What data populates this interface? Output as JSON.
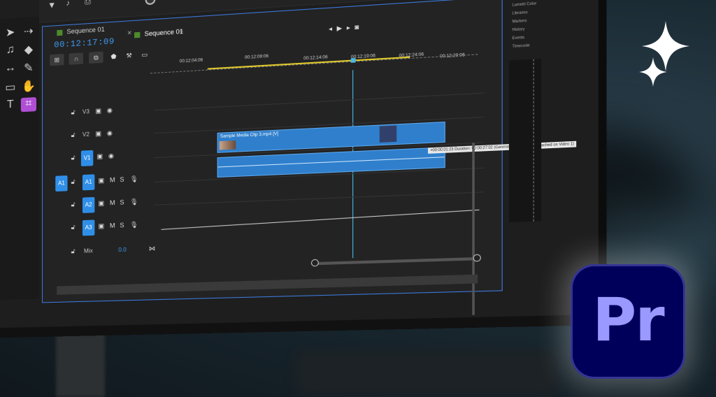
{
  "sequence": {
    "tab_inactive": "Sequence 01",
    "tab_active": "Sequence 01",
    "timecode": "00:12:17:09"
  },
  "ruler": {
    "labels": [
      "00:12:04:06",
      "00:12:09:06",
      "00:12:14:06",
      "00:12:19:06",
      "00:12:24:06",
      "00:12:29:06"
    ]
  },
  "tracks": {
    "video": [
      {
        "label": "V3"
      },
      {
        "label": "V2"
      },
      {
        "label": "V1",
        "source": "V1"
      }
    ],
    "audio": [
      {
        "label": "A1",
        "source": "A1"
      },
      {
        "label": "A2"
      },
      {
        "label": "A3"
      }
    ],
    "mix_label": "Mix",
    "mix_value": "0.0",
    "mute": "M",
    "solo": "S"
  },
  "clip": {
    "name": "Sample Media Clip 3.mp4 [V]",
    "tooltip": "+00:00:01:23 Duration: 00:00:27:02 (Generative extend limit reached on Video 1)"
  },
  "side_panel": [
    "Lumetri Color",
    "Libraries",
    "Markers",
    "History",
    "Events",
    "Timecode"
  ],
  "logo": {
    "text": "Pr"
  },
  "colors": {
    "accent": "#2f8fe8",
    "pr_bg": "#00005b",
    "pr_text": "#9999ff",
    "timecode": "#3e9bf4",
    "playhead": "#48b8e8",
    "work_area": "#e0c92b"
  }
}
